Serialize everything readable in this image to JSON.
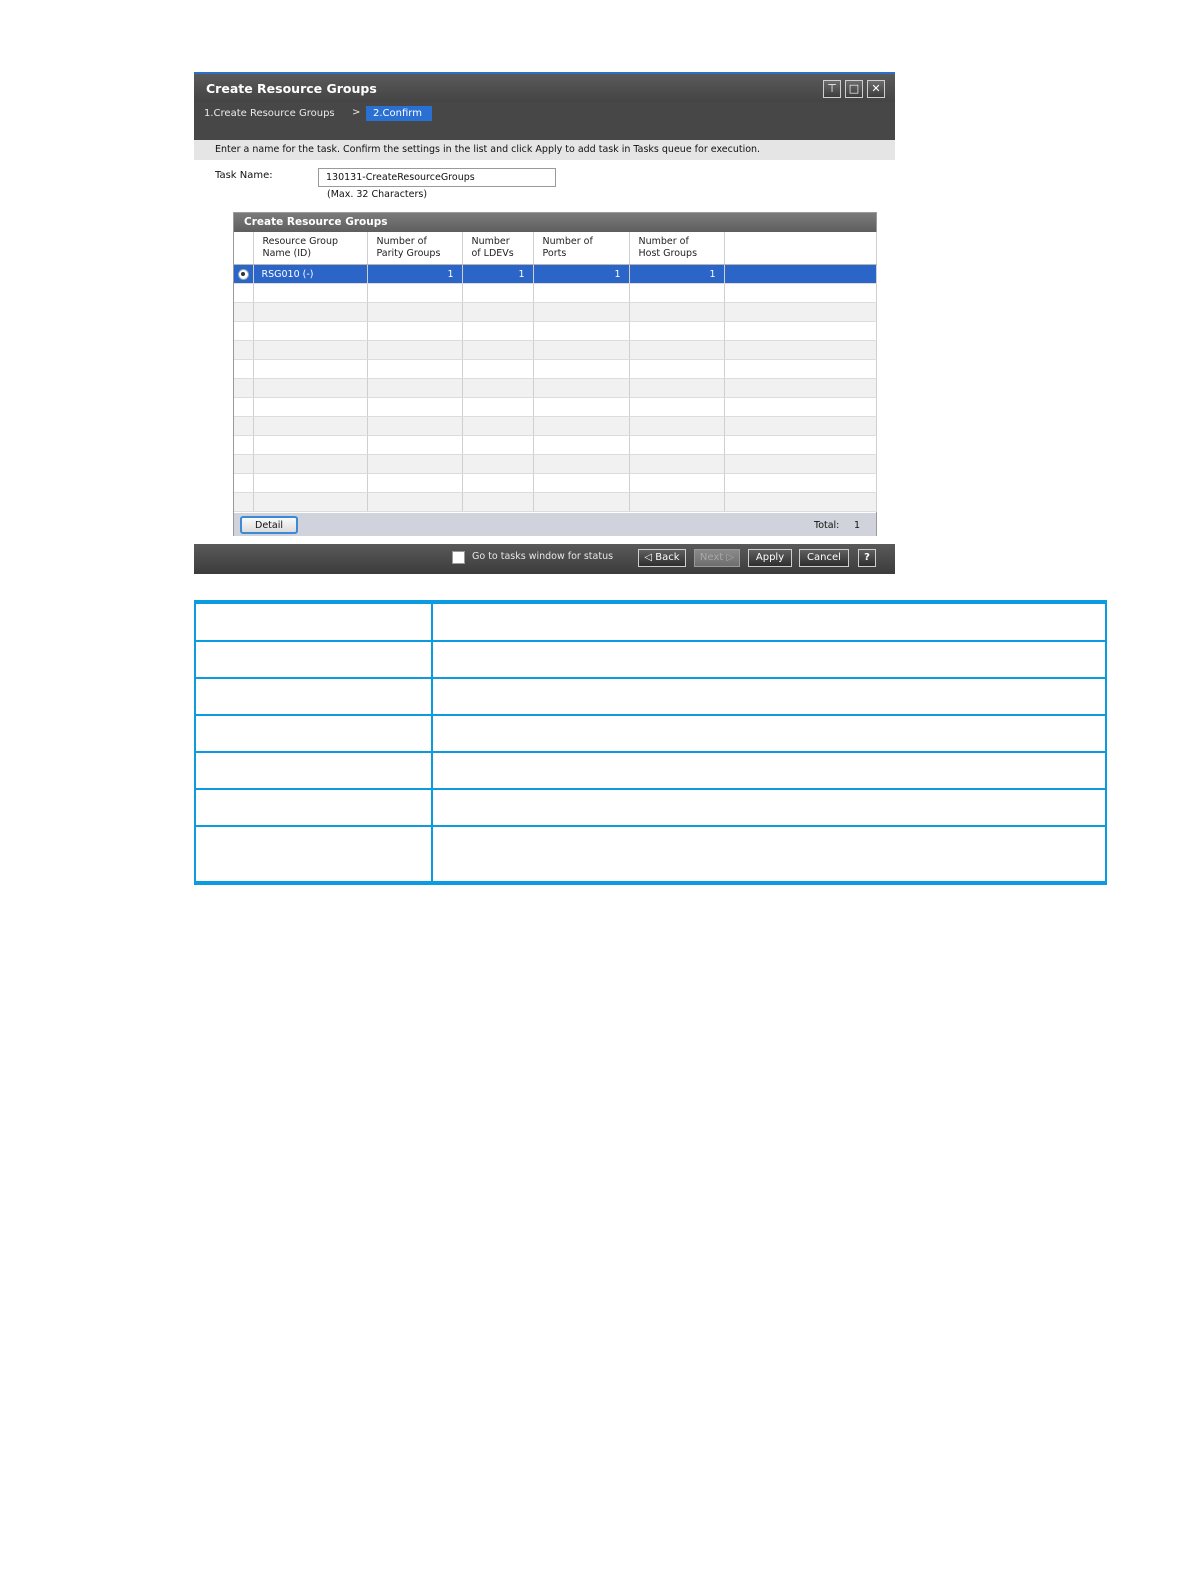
{
  "window": {
    "title": "Create Resource Groups",
    "controls": {
      "restore_icon": "⊤",
      "maximize_icon": "□",
      "close_icon": "✕"
    }
  },
  "wizard": {
    "step1": "1.Create Resource Groups",
    "separator": ">",
    "step2": "2.Confirm"
  },
  "instruction": "Enter a name for the task. Confirm the settings in the list and click Apply to add task in Tasks queue for execution.",
  "task": {
    "label": "Task Name:",
    "value": "130131-CreateResourceGroups",
    "hint": "(Max. 32 Characters)"
  },
  "table": {
    "title": "Create Resource Groups",
    "columns": [
      [
        "Resource Group",
        "Name (ID)"
      ],
      [
        "Number of",
        "Parity Groups"
      ],
      [
        "Number",
        "of LDEVs"
      ],
      [
        "Number of",
        "Ports"
      ],
      [
        "Number of",
        "Host Groups"
      ]
    ],
    "rows": [
      {
        "name": "RSG010 (-)",
        "parity_groups": "1",
        "ldevs": "1",
        "ports": "1",
        "host_groups": "1"
      }
    ],
    "empty_row_count": 12,
    "detail_label": "Detail",
    "total_label": "Total:",
    "total_value": "1"
  },
  "footer": {
    "go_to_tasks_label": "Go to tasks window for status",
    "back_label": "◁ Back",
    "next_label": "Next ▷",
    "apply_label": "Apply",
    "cancel_label": "Cancel",
    "help_label": "?"
  },
  "colors": {
    "selected_row": "#2b65c8",
    "active_step": "#2a6fd2",
    "table_border": "#0b9be0"
  }
}
